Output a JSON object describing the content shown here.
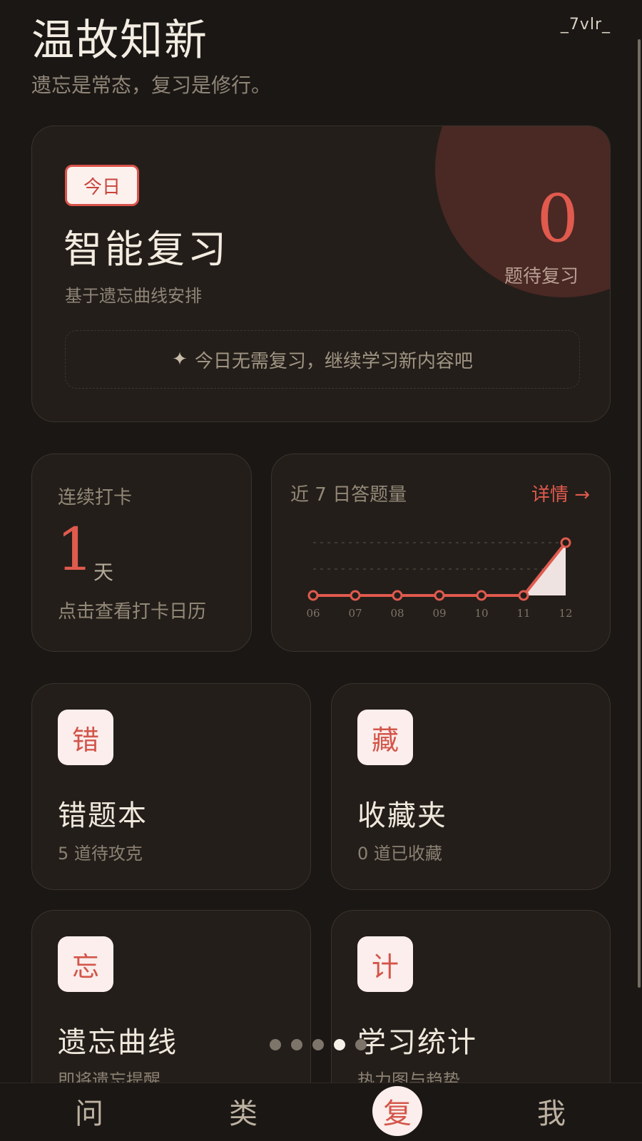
{
  "header": {
    "title": "温故知新",
    "subtitle": "遗忘是常态，复习是修行。",
    "user_tag": "_7vlr_"
  },
  "review_card": {
    "badge": "今日",
    "title": "智能复习",
    "subtitle": "基于遗忘曲线安排",
    "pending_count": "0",
    "pending_label": "题待复习",
    "hint_icon": "sparkle-icon",
    "hint": "今日无需复习，继续学习新内容吧"
  },
  "streak_card": {
    "label": "连续打卡",
    "count": "1",
    "unit": "天",
    "hint": "点击查看打卡日历"
  },
  "chart_card": {
    "title": "近 7 日答题量",
    "detail_link": "详情 →"
  },
  "chart_data": {
    "type": "area",
    "categories": [
      "06",
      "07",
      "08",
      "09",
      "10",
      "11",
      "12"
    ],
    "values": [
      0,
      0,
      0,
      0,
      0,
      0,
      2
    ],
    "ylim": [
      0,
      2
    ],
    "grid": true,
    "colors": {
      "line": "#e05a4e",
      "fill": "#fbeeec",
      "grid": "#4a423a",
      "tick": "#7e7467"
    }
  },
  "features": [
    {
      "icon": "错",
      "title": "错题本",
      "subtitle": "5 道待攻克"
    },
    {
      "icon": "藏",
      "title": "收藏夹",
      "subtitle": "0 道已收藏"
    },
    {
      "icon": "忘",
      "title": "遗忘曲线",
      "subtitle": "即将遗忘提醒"
    },
    {
      "icon": "计",
      "title": "学习统计",
      "subtitle": "热力图与趋势"
    }
  ],
  "pager": {
    "count": 5,
    "active_index": 3
  },
  "bottom_nav": [
    {
      "label": "问",
      "active": false
    },
    {
      "label": "类",
      "active": false
    },
    {
      "label": "复",
      "active": true
    },
    {
      "label": "我",
      "active": false
    }
  ],
  "colors": {
    "accent": "#e05a4e",
    "background": "#1b1714",
    "card": "#231e1a"
  }
}
